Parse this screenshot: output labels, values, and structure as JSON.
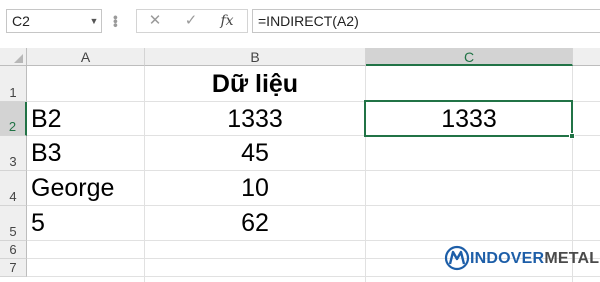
{
  "formula_bar": {
    "name_box": "C2",
    "cancel_icon": "✕",
    "enter_icon": "✓",
    "fx_icon": "fx",
    "formula": "=INDIRECT(A2)"
  },
  "columns": [
    "A",
    "B",
    "C"
  ],
  "rows": [
    "1",
    "2",
    "3",
    "4",
    "5",
    "6",
    "7"
  ],
  "cells": {
    "B1": "Dữ liệu",
    "A2": "B2",
    "B2": "1333",
    "C2": "1333",
    "A3": "B3",
    "B3": "45",
    "A4": "George",
    "B4": "10",
    "A5": "5",
    "B5": "62"
  },
  "selection": {
    "cell": "C2",
    "column": "C",
    "row": "2"
  },
  "watermark": {
    "prefix": "INDOVER",
    "suffix": "METAL"
  },
  "colors": {
    "accent": "#217346",
    "header_bg": "#efefef",
    "grid": "#e1e1e1",
    "logo_blue": "#1d5ea8"
  }
}
